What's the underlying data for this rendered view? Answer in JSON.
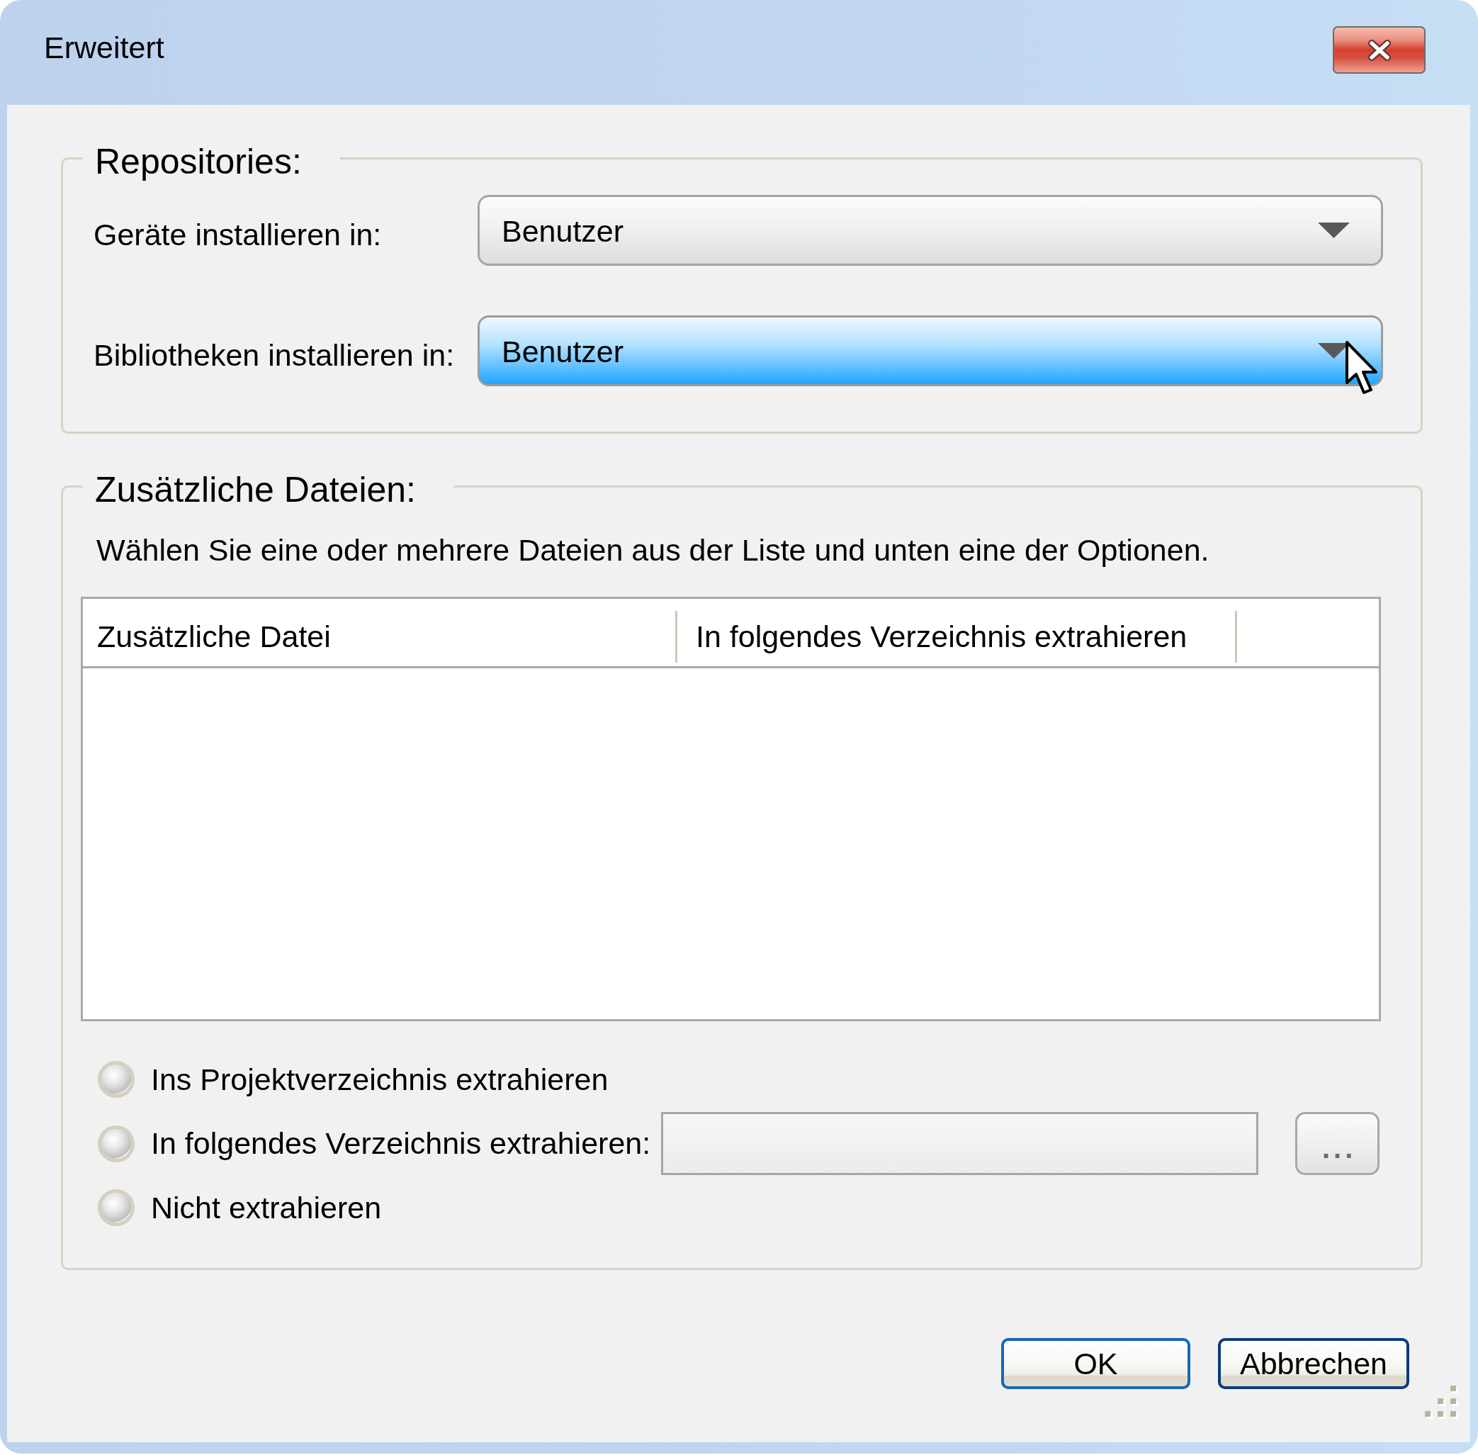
{
  "window": {
    "title": "Erweitert"
  },
  "repositories": {
    "title": "Repositories:",
    "rows": [
      {
        "label": "Geräte installieren in:",
        "value": "Benutzer",
        "hovered": false
      },
      {
        "label": "Bibliotheken installieren in:",
        "value": "Benutzer",
        "hovered": true
      }
    ]
  },
  "additional_files": {
    "title": "Zusätzliche Dateien:",
    "description": "Wählen Sie eine oder mehrere Dateien aus der Liste und unten eine der Optionen.",
    "table": {
      "columns": [
        "Zusätzliche Datei",
        "In folgendes Verzeichnis extrahieren"
      ]
    },
    "options": [
      {
        "kind": "plain",
        "label": "Ins Projektverzeichnis extrahieren",
        "selected": false
      },
      {
        "kind": "path",
        "label": "In folgendes Verzeichnis extrahieren:",
        "selected": false,
        "browse_button": "..."
      },
      {
        "kind": "plain",
        "label": "Nicht extrahieren",
        "selected": false
      }
    ]
  },
  "buttons": [
    {
      "label": "OK",
      "default": true
    },
    {
      "label": "Abbrechen",
      "default": false
    }
  ]
}
